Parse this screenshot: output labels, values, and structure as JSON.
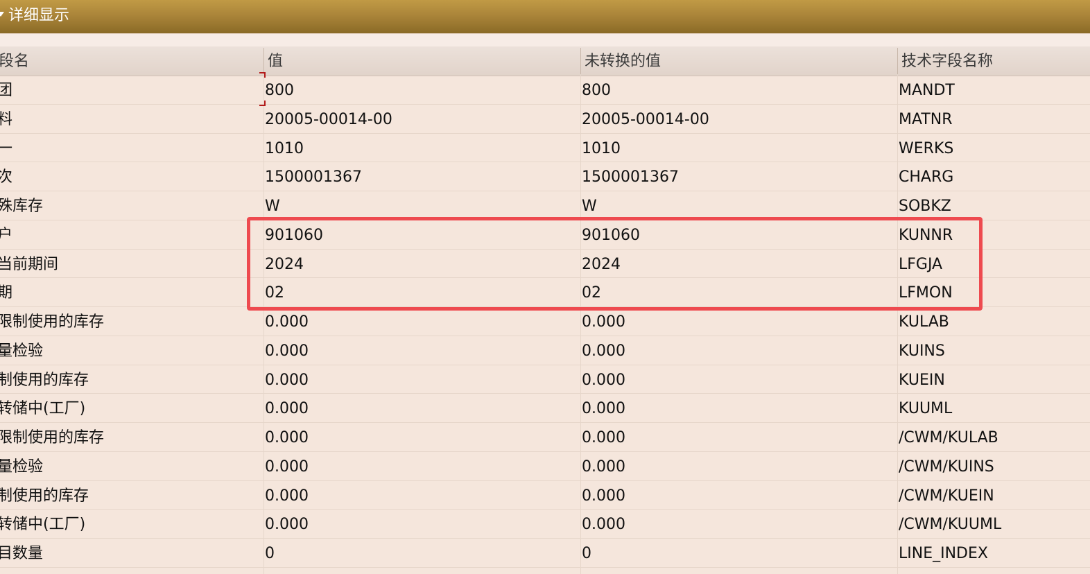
{
  "window": {
    "title": "详细显示",
    "collapse_icon": "triangle-down-icon"
  },
  "table": {
    "columns": [
      "段名",
      "值",
      "未转换的值",
      "技术字段名称"
    ],
    "rows": [
      {
        "field": "团",
        "value": "800",
        "raw": "800",
        "tech": "MANDT"
      },
      {
        "field": "料",
        "value": "20005-00014-00",
        "raw": "20005-00014-00",
        "tech": "MATNR"
      },
      {
        "field": "一",
        "value": "1010",
        "raw": "1010",
        "tech": "WERKS"
      },
      {
        "field": "次",
        "value": "1500001367",
        "raw": "1500001367",
        "tech": "CHARG"
      },
      {
        "field": "殊库存",
        "value": "W",
        "raw": "W",
        "tech": "SOBKZ"
      },
      {
        "field": "户",
        "value": "901060",
        "raw": "901060",
        "tech": "KUNNR"
      },
      {
        "field": "当前期间",
        "value": "2024",
        "raw": "2024",
        "tech": "LFGJA"
      },
      {
        "field": "期",
        "value": "02",
        "raw": "02",
        "tech": "LFMON"
      },
      {
        "field": "限制使用的库存",
        "value": "0.000",
        "raw": "0.000",
        "tech": "KULAB"
      },
      {
        "field": "量检验",
        "value": "0.000",
        "raw": "0.000",
        "tech": "KUINS"
      },
      {
        "field": "制使用的库存",
        "value": "0.000",
        "raw": "0.000",
        "tech": "KUEIN"
      },
      {
        "field": "转储中(工厂)",
        "value": "0.000",
        "raw": "0.000",
        "tech": "KUUML"
      },
      {
        "field": "限制使用的库存",
        "value": "0.000",
        "raw": "0.000",
        "tech": "/CWM/KULAB"
      },
      {
        "field": "量检验",
        "value": "0.000",
        "raw": "0.000",
        "tech": "/CWM/KUINS"
      },
      {
        "field": "制使用的库存",
        "value": "0.000",
        "raw": "0.000",
        "tech": "/CWM/KUEIN"
      },
      {
        "field": "转储中(工厂)",
        "value": "0.000",
        "raw": "0.000",
        "tech": "/CWM/KUUML"
      },
      {
        "field": "目数量",
        "value": "0",
        "raw": "0",
        "tech": "LINE_INDEX"
      }
    ]
  },
  "colors": {
    "titlebar": "#ab853a",
    "grid_background": "#f5e6dc",
    "highlight_border": "#ee4a4f",
    "focus_marker": "#b31b1b"
  }
}
